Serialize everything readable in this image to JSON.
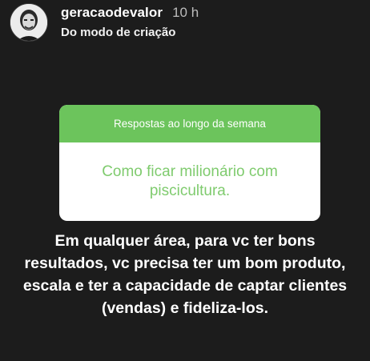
{
  "post": {
    "username": "geracaodevalor",
    "time": "10 h",
    "subtitle": "Do modo de criação"
  },
  "question": {
    "header": "Respostas ao longo da semana",
    "body_line1": "Como ficar milionário com",
    "body_line2": "piscicultura.",
    "header_color": "#6cc45c",
    "body_color": "#7fcb6e"
  },
  "caption": {
    "line1": "Em qualquer área, para vc ter bons",
    "line2": "resultados, vc precisa ter um bom produto,",
    "line3": "escala e ter a capacidade de captar clientes",
    "line4": "(vendas) e fideliza-los."
  },
  "icons": {
    "avatar": "profile-photo"
  }
}
